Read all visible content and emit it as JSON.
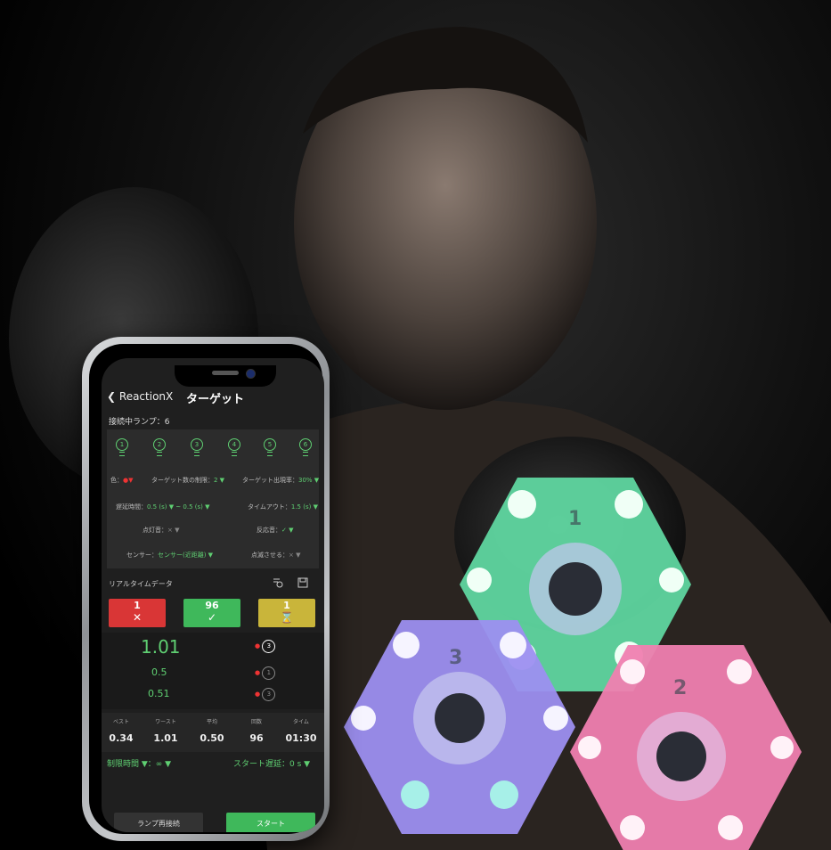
{
  "app": {
    "back_label": "ReactionX",
    "title": "ターゲット",
    "connected_lamps": "接続中ランプ：6"
  },
  "lamps": [
    "1",
    "2",
    "3",
    "4",
    "5",
    "6"
  ],
  "settings": {
    "color_label": "色：",
    "target_limit_label": "ターゲット数の制限：",
    "target_limit_value": "2 ▼",
    "appear_rate_label": "ターゲット出現率：",
    "appear_rate_value": "30% ▼",
    "delay_label": "遅延時間：",
    "delay_value": "0.5 (s) ▼ ~ 0.5 (s) ▼",
    "timeout_label": "タイムアウト：",
    "timeout_value": "1.5 (s) ▼",
    "light_sound_label": "点灯音：",
    "light_sound_value": "× ▼",
    "react_sound_label": "反応音：",
    "react_sound_value": "✓ ▼",
    "sensor_label": "センサー：",
    "sensor_value": "センサー(近距離) ▼",
    "blink_label": "点滅させる：",
    "blink_value": "× ▼"
  },
  "realtime": {
    "title": "リアルタイムデータ",
    "miss_count": "1",
    "hit_count": "96",
    "timeout_count": "1"
  },
  "times": {
    "latest": "1.01",
    "prev1": "0.5",
    "prev2": "0.51",
    "rank1": "3",
    "rank2": "1",
    "rank3": "3"
  },
  "stats": {
    "headers": [
      "ベスト",
      "ワースト",
      "平均",
      "回数",
      "タイム"
    ],
    "values": [
      "0.34",
      "1.01",
      "0.50",
      "96",
      "01:30"
    ]
  },
  "footer": {
    "limit": "制限時間 ▼：∞ ▼",
    "start_delay": "スタート遅延：0 s ▼",
    "reconnect": "ランプ再接続",
    "start": "スタート"
  },
  "hexagons": [
    {
      "label": "1",
      "color": "#5fd6a0"
    },
    {
      "label": "3",
      "color": "#9c8ff0"
    },
    {
      "label": "2",
      "color": "#ef7fb0"
    }
  ],
  "colors": {
    "accent": "#3fb85b",
    "miss": "#d93636",
    "timeout": "#c9b53a"
  }
}
